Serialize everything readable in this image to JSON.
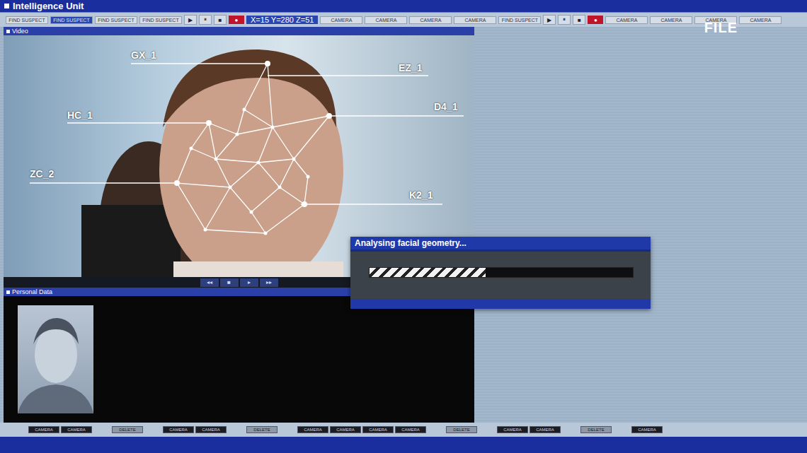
{
  "window": {
    "title": "Intelligence Unit"
  },
  "badge": "FILE",
  "toolbar": [
    {
      "kind": "button",
      "label": "FIND SUSPECT",
      "selected": false
    },
    {
      "kind": "button",
      "label": "FIND SUSPECT",
      "selected": true
    },
    {
      "kind": "button",
      "label": "FIND SUSPECT",
      "selected": false
    },
    {
      "kind": "button",
      "label": "FIND SUSPECT",
      "selected": false
    },
    {
      "kind": "icon",
      "label": "▶",
      "selected": false
    },
    {
      "kind": "icon",
      "label": "⏸",
      "selected": false
    },
    {
      "kind": "icon",
      "label": "■",
      "selected": false
    },
    {
      "kind": "record",
      "label": "●",
      "selected": false
    },
    {
      "kind": "readout",
      "label": "X=15 Y=280 Z=51",
      "selected": false
    },
    {
      "kind": "button",
      "label": "CAMERA",
      "selected": false
    },
    {
      "kind": "button",
      "label": "CAMERA",
      "selected": false
    },
    {
      "kind": "button",
      "label": "CAMERA",
      "selected": false
    },
    {
      "kind": "button",
      "label": "CAMERA",
      "selected": false
    },
    {
      "kind": "button",
      "label": "FIND SUSPECT",
      "selected": false
    },
    {
      "kind": "icon",
      "label": "▶",
      "selected": false
    },
    {
      "kind": "icon",
      "label": "⏸",
      "selected": false
    },
    {
      "kind": "icon",
      "label": "■",
      "selected": false
    },
    {
      "kind": "record",
      "label": "●",
      "selected": false
    },
    {
      "kind": "button",
      "label": "CAMERA",
      "selected": false
    },
    {
      "kind": "button",
      "label": "CAMERA",
      "selected": false
    },
    {
      "kind": "button",
      "label": "CAMERA",
      "selected": false
    },
    {
      "kind": "button",
      "label": "CAMERA",
      "selected": false
    }
  ],
  "video": {
    "title": "Video",
    "labels": [
      "GX_1",
      "EZ_1",
      "HC_1",
      "D4_1",
      "ZC_2",
      "K2_1"
    ],
    "controls": [
      "◂◂",
      "■",
      "▸",
      "▸▸"
    ]
  },
  "personal_data": {
    "title": "Personal Data"
  },
  "dialog": {
    "title": "Analysing facial geometry...",
    "level": 0.44
  },
  "bottom_buttons": [
    {
      "kind": "camera",
      "label": "CAMERA"
    },
    {
      "kind": "camera",
      "label": "CAMERA"
    },
    {
      "kind": "delete",
      "label": "DELETE"
    },
    {
      "kind": "camera",
      "label": "CAMERA"
    },
    {
      "kind": "camera",
      "label": "CAMERA"
    },
    {
      "kind": "delete",
      "label": "DELETE"
    },
    {
      "kind": "camera",
      "label": "CAMERA"
    },
    {
      "kind": "camera",
      "label": "CAMERA"
    },
    {
      "kind": "camera",
      "label": "CAMERA"
    },
    {
      "kind": "camera",
      "label": "CAMERA"
    },
    {
      "kind": "delete",
      "label": "DELETE"
    },
    {
      "kind": "camera",
      "label": "CAMERA"
    },
    {
      "kind": "camera",
      "label": "CAMERA"
    },
    {
      "kind": "delete",
      "label": "DELETE"
    },
    {
      "kind": "camera",
      "label": "CAMERA"
    }
  ]
}
